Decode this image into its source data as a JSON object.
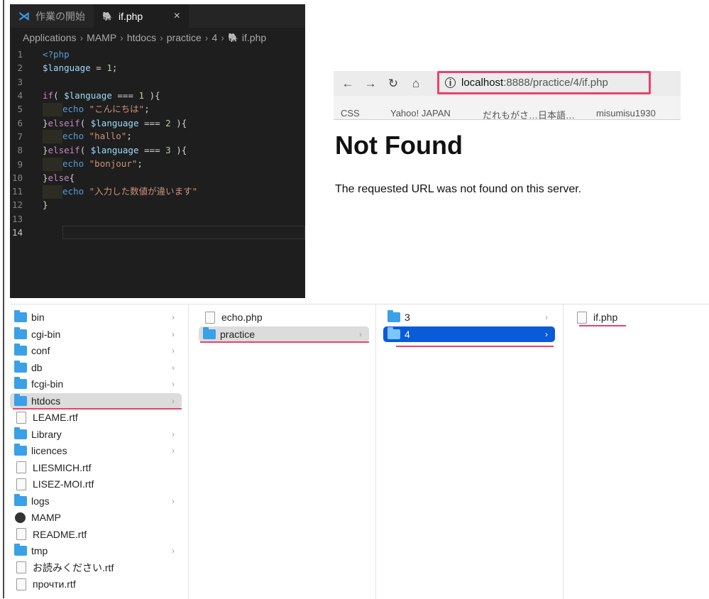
{
  "vscode": {
    "tabs": [
      "作業の開始",
      "if.php"
    ],
    "close_glyph": "×",
    "breadcrumb": [
      "Applications",
      "MAMP",
      "htdocs",
      "practice",
      "4",
      "if.php"
    ],
    "line_numbers": [
      "1",
      "2",
      "3",
      "4",
      "5",
      "6",
      "7",
      "8",
      "9",
      "10",
      "11",
      "12",
      "13",
      "14"
    ]
  },
  "browser": {
    "url_host": "localhost",
    "url_path": ":8888/practice/4/if.php",
    "bookmarks": [
      "CSS",
      "Yahoo! JAPAN",
      "だれもがさ…日本語…",
      "misumisu1930"
    ],
    "heading": "Not Found",
    "message": "The requested URL was not found on this server."
  },
  "finder": {
    "col1": [
      "bin",
      "cgi-bin",
      "conf",
      "db",
      "fcgi-bin",
      "htdocs",
      "LEAME.rtf",
      "Library",
      "licences",
      "LIESMICH.rtf",
      "LISEZ-MOI.rtf",
      "logs",
      "MAMP",
      "README.rtf",
      "tmp",
      "お読みください.rtf",
      "прочти.rtf"
    ],
    "col2": [
      "echo.php",
      "practice"
    ],
    "col3": [
      "3",
      "4"
    ],
    "col4": [
      "if.php"
    ]
  },
  "colors": {
    "highlight": "#e8426a",
    "selection": "#0a5bd8"
  }
}
